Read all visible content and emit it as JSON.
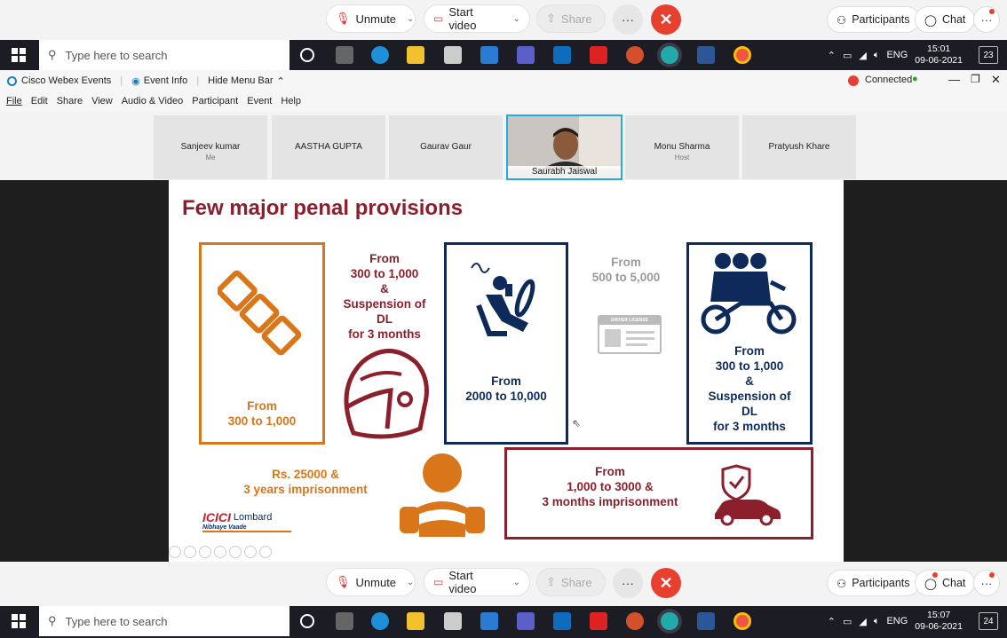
{
  "meeting_toolbar": {
    "unmute": "Unmute",
    "start_video": "Start video",
    "share": "Share",
    "participants": "Participants",
    "chat": "Chat"
  },
  "taskbar_top": {
    "search_placeholder": "Type here to search",
    "lang": "ENG",
    "time": "15:01",
    "date": "09-06-2021",
    "notifications": "23"
  },
  "taskbar_bottom": {
    "search_placeholder": "Type here to search",
    "lang": "ENG",
    "time": "15:07",
    "date": "09-06-2021",
    "notifications": "24"
  },
  "webex": {
    "app_name": "Cisco Webex Events",
    "event_info": "Event Info",
    "hide_menu": "Hide Menu Bar",
    "status": "Connected",
    "menu": [
      "File",
      "Edit",
      "Share",
      "View",
      "Audio & Video",
      "Participant",
      "Event",
      "Help"
    ]
  },
  "participants": [
    {
      "name": "Sanjeev kumar",
      "sub": "Me"
    },
    {
      "name": "AASTHA GUPTA",
      "sub": ""
    },
    {
      "name": "Gaurav Gaur",
      "sub": ""
    },
    {
      "name": "Saurabh Jaiswal",
      "sub": ""
    },
    {
      "name": "Monu Sharma",
      "sub": "Host"
    },
    {
      "name": "Pratyush Khare",
      "sub": ""
    }
  ],
  "slide": {
    "title": "Few major penal provisions",
    "seatbelt_fine": [
      "From",
      "300 to 1,000"
    ],
    "helmet_fine": [
      "From",
      "300 to 1,000",
      "&",
      "Suspension of",
      "DL",
      "for 3 months"
    ],
    "mobile_fine": [
      "From",
      "2000 to 10,000"
    ],
    "license_fine": [
      "From",
      "500 to 5,000"
    ],
    "triple_fine": [
      "From",
      "300 to 1,000",
      "&",
      "Suspension of",
      "DL",
      "for 3 months"
    ],
    "juvenile_fine": [
      "Rs. 25000 &",
      "3 years imprisonment"
    ],
    "insurance_fine": [
      "From",
      "1,000 to 3000 &",
      "3 months imprisonment"
    ],
    "license_card_label": "DRIVER LICENSE",
    "logo_brand": "ICICI",
    "logo_name": "Lombard",
    "logo_tagline": "Nibhaye Vaade"
  },
  "colors": {
    "orange": "#d9761a",
    "maroon": "#8b1f2c",
    "navy": "#0e2a5a",
    "end_red": "#e8402e"
  }
}
